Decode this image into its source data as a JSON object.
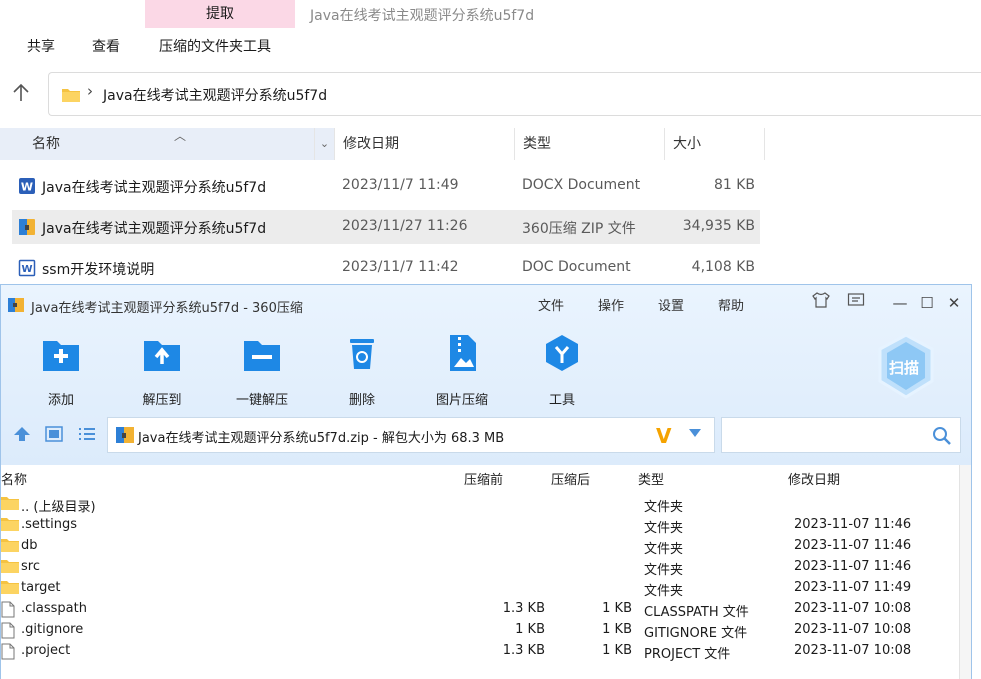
{
  "explorer": {
    "ribbon_active_tab": "提取",
    "window_title": "Java在线考试主观题评分系统u5f7d",
    "menu": [
      "共享",
      "查看",
      "压缩的文件夹工具"
    ],
    "address": "Java在线考试主观题评分系统u5f7d",
    "columns": {
      "name": "名称",
      "date": "修改日期",
      "type": "类型",
      "size": "大小"
    },
    "files": [
      {
        "icon": "word-docx-icon",
        "name": "Java在线考试主观题评分系统u5f7d",
        "date": "2023/11/7 11:49",
        "type": "DOCX Document",
        "size": "81 KB",
        "selected": false
      },
      {
        "icon": "zip-archive-icon",
        "name": "Java在线考试主观题评分系统u5f7d",
        "date": "2023/11/27 11:26",
        "type": "360压缩 ZIP 文件",
        "size": "34,935 KB",
        "selected": true
      },
      {
        "icon": "word-doc-icon",
        "name": "ssm开发环境说明",
        "date": "2023/11/7 11:42",
        "type": "DOC Document",
        "size": "4,108 KB",
        "selected": false
      }
    ]
  },
  "zip": {
    "title": "Java在线考试主观题评分系统u5f7d - 360压缩",
    "menu": [
      "文件",
      "操作",
      "设置",
      "帮助"
    ],
    "tools": [
      {
        "icon": "add-icon",
        "label": "添加"
      },
      {
        "icon": "extract-to-icon",
        "label": "解压到"
      },
      {
        "icon": "one-click-extract-icon",
        "label": "一键解压"
      },
      {
        "icon": "delete-icon",
        "label": "删除"
      },
      {
        "icon": "image-compress-icon",
        "label": "图片压缩"
      },
      {
        "icon": "tools-icon",
        "label": "工具"
      }
    ],
    "scan_label": "扫描",
    "path_text": "Java在线考试主观题评分系统u5f7d.zip - 解包大小为 68.3 MB",
    "path_badge": "V",
    "search_placeholder": "",
    "columns": {
      "name": "名称",
      "compressed": "压缩前",
      "uncompressed": "压缩后",
      "type": "类型",
      "date": "修改日期"
    },
    "rows": [
      {
        "kind": "folder",
        "name": ".. (上级目录)",
        "before": "",
        "after": "",
        "type": "文件夹",
        "date": ""
      },
      {
        "kind": "folder",
        "name": ".settings",
        "before": "",
        "after": "",
        "type": "文件夹",
        "date": "2023-11-07 11:46"
      },
      {
        "kind": "folder",
        "name": "db",
        "before": "",
        "after": "",
        "type": "文件夹",
        "date": "2023-11-07 11:46"
      },
      {
        "kind": "folder",
        "name": "src",
        "before": "",
        "after": "",
        "type": "文件夹",
        "date": "2023-11-07 11:46"
      },
      {
        "kind": "folder",
        "name": "target",
        "before": "",
        "after": "",
        "type": "文件夹",
        "date": "2023-11-07 11:49"
      },
      {
        "kind": "file",
        "name": ".classpath",
        "before": "1.3 KB",
        "after": "1 KB",
        "type": "CLASSPATH 文件",
        "date": "2023-11-07 10:08"
      },
      {
        "kind": "file",
        "name": ".gitignore",
        "before": "1 KB",
        "after": "1 KB",
        "type": "GITIGNORE 文件",
        "date": "2023-11-07 10:08"
      },
      {
        "kind": "file",
        "name": ".project",
        "before": "1.3 KB",
        "after": "1 KB",
        "type": "PROJECT 文件",
        "date": "2023-11-07 10:08"
      }
    ]
  },
  "colors": {
    "accent": "#1e88e5",
    "selection": "#ececec",
    "ribbon_tab": "#fbd8e6",
    "zip_header": "#dcebfb",
    "folder": "#f5c342",
    "v_badge": "#f5a300"
  }
}
